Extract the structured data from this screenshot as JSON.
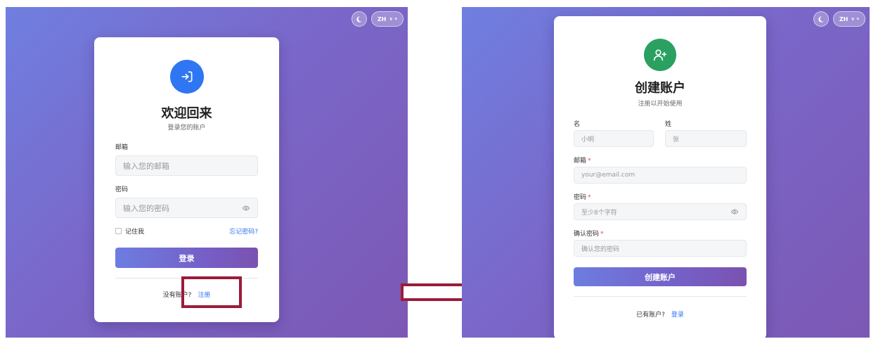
{
  "login": {
    "theme_icon": "moon-icon",
    "lang_label": "ZH",
    "lang_caret": "∨ ▾",
    "title": "欢迎回来",
    "subtitle": "登录您的账户",
    "email_label": "邮箱",
    "email_placeholder": "输入您的邮箱",
    "password_label": "密码",
    "password_placeholder": "输入您的密码",
    "remember_label": "记住我",
    "forgot_link": "忘记密码?",
    "submit_label": "登录",
    "footer_prompt": "没有账户?",
    "register_link": "注册"
  },
  "register": {
    "theme_icon": "moon-icon",
    "lang_label": "ZH",
    "lang_caret": "∨ ▾",
    "title": "创建账户",
    "subtitle": "注册以开始使用",
    "first_name_label": "名",
    "first_name_placeholder": "小明",
    "last_name_label": "姓",
    "last_name_placeholder": "张",
    "email_label": "邮箱",
    "email_placeholder": "your@email.com",
    "password_label": "密码",
    "password_placeholder": "至少8个字符",
    "confirm_label": "确认密码",
    "confirm_placeholder": "确认您的密码",
    "required_mark": "*",
    "submit_label": "创建账户",
    "footer_prompt": "已有账户?",
    "login_link": "登录"
  },
  "colors": {
    "accent_blue": "#2f76f2",
    "accent_green": "#2aa061",
    "highlight": "#9b1c3a",
    "arrow": "#9b1c3a"
  }
}
